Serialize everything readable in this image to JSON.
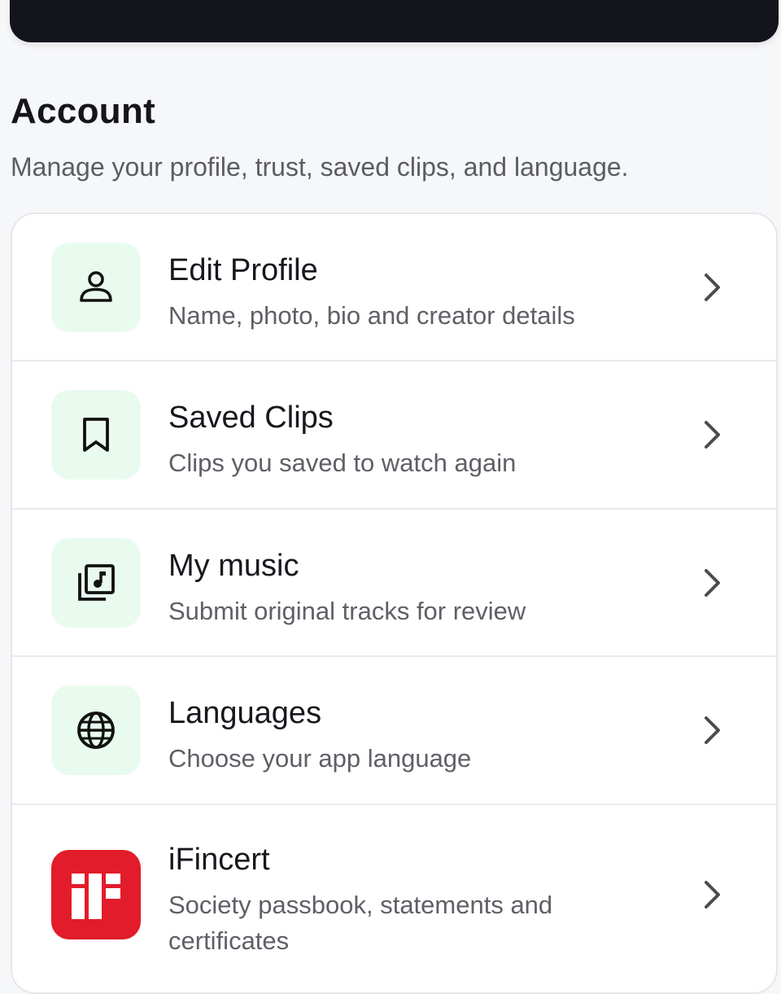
{
  "header": {
    "title": "Account",
    "subtitle": "Manage your profile, trust, saved clips, and language."
  },
  "menu": [
    {
      "icon": "person-icon",
      "title": "Edit Profile",
      "subtitle": "Name, photo, bio and creator details"
    },
    {
      "icon": "bookmark-icon",
      "title": "Saved Clips",
      "subtitle": "Clips you saved to watch again"
    },
    {
      "icon": "music-library-icon",
      "title": "My music",
      "subtitle": "Submit original tracks for review"
    },
    {
      "icon": "globe-icon",
      "title": "Languages",
      "subtitle": "Choose your app language"
    },
    {
      "icon": "ifincert-logo",
      "title": "iFincert",
      "subtitle": "Society passbook, statements and certificates"
    }
  ],
  "colors": {
    "icon_tile_bg": "#e9fbef",
    "brand_red": "#e21c2a",
    "top_card": "#14151c"
  }
}
